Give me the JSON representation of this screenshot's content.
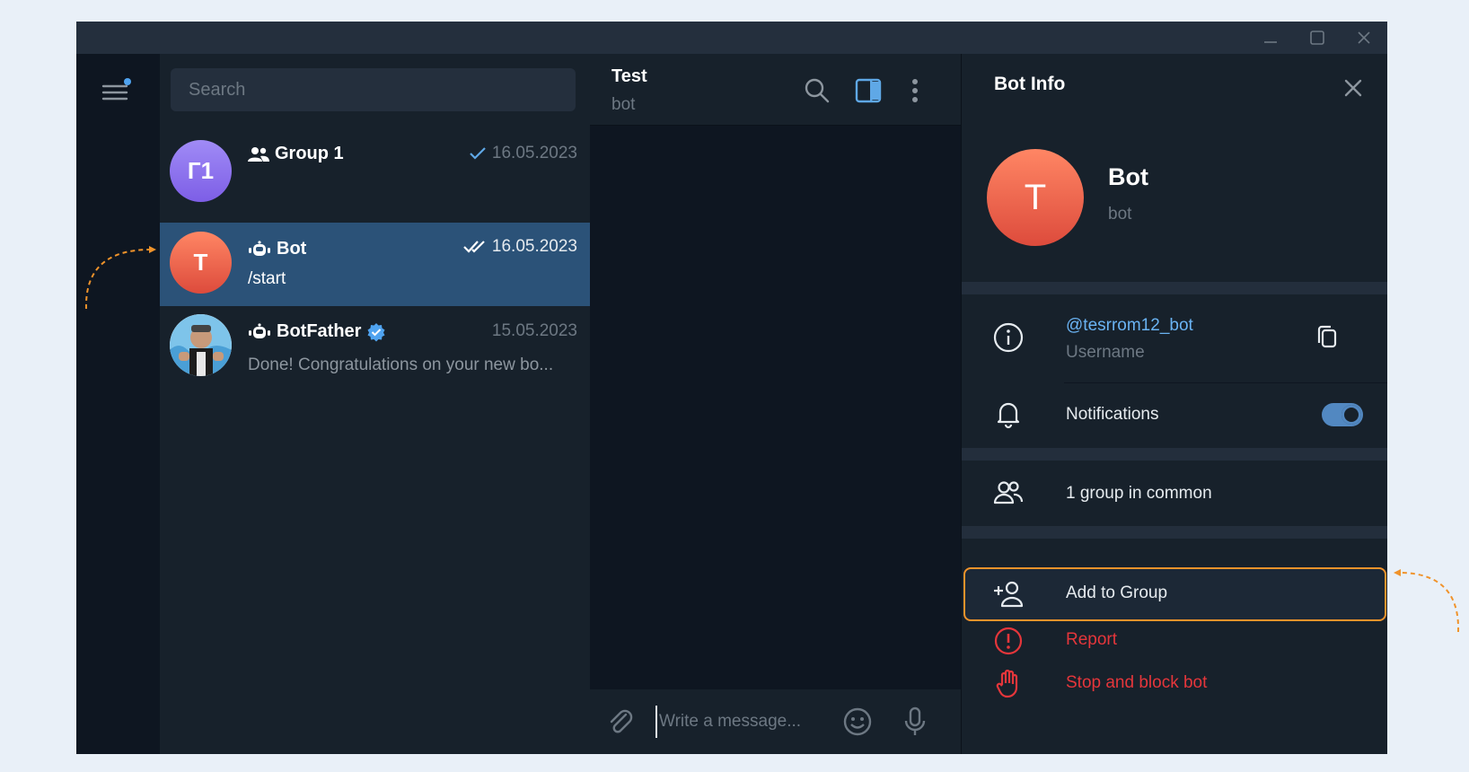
{
  "window": {
    "controls": [
      "minimize",
      "maximize",
      "close"
    ]
  },
  "sidebar": {
    "menu_icon": "hamburger-menu-icon",
    "badge_color": "#4fa3f0"
  },
  "search": {
    "placeholder": "Search"
  },
  "chats": [
    {
      "avatar_text": "Г1",
      "avatar_color": "#8c6cf0",
      "name": "Group 1",
      "type_icon": "group-icon",
      "date": "16.05.2023",
      "status": "sent",
      "preview": ""
    },
    {
      "avatar_text": "T",
      "avatar_color": "#e8614b",
      "name": "Bot",
      "type_icon": "bot-icon",
      "date": "16.05.2023",
      "status": "read",
      "preview": "/start",
      "active": true
    },
    {
      "avatar_text": "",
      "avatar_color": "#ffffff",
      "name": "BotFather",
      "type_icon": "bot-icon",
      "verified": true,
      "date": "15.05.2023",
      "preview": "Done! Congratulations on your new bo..."
    }
  ],
  "chat": {
    "title": "Test",
    "subtitle": "bot",
    "composer_placeholder": "Write a message..."
  },
  "info": {
    "title": "Bot Info",
    "avatar_text": "T",
    "name": "Bot",
    "subtitle": "bot",
    "username": "@tesrrom12_bot",
    "username_label": "Username",
    "notifications_label": "Notifications",
    "notifications_on": true,
    "groups_common": "1 group in common",
    "add_to_group": "Add to Group",
    "report": "Report",
    "stop_block": "Stop and block bot"
  },
  "colors": {
    "accent": "#5288c1",
    "danger": "#e5363b",
    "highlight": "#f0932b",
    "link": "#6ab3f3"
  }
}
